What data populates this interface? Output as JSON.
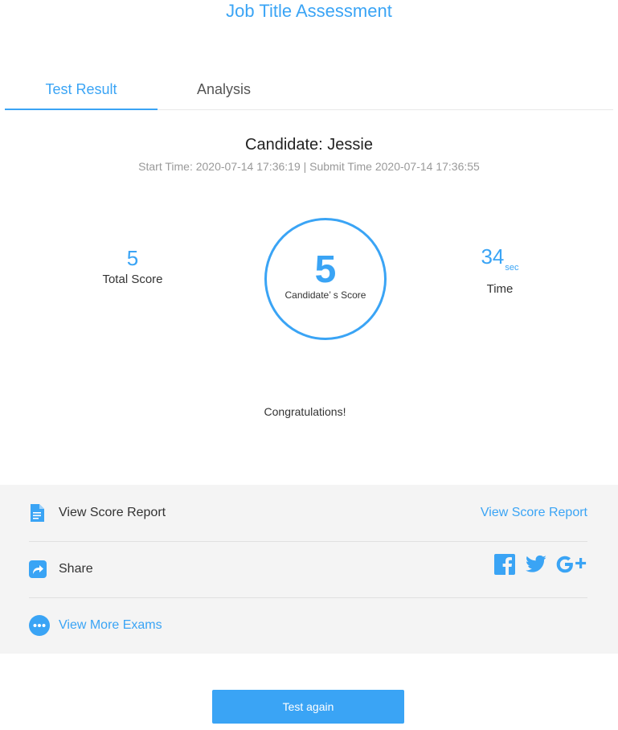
{
  "page": {
    "title": "Job Title Assessment"
  },
  "tabs": [
    {
      "label": "Test Result",
      "active": true
    },
    {
      "label": "Analysis",
      "active": false
    }
  ],
  "candidate": {
    "heading": "Candidate: Jessie",
    "times": "Start Time:  2020-07-14 17:36:19 | Submit Time 2020-07-14 17:36:55"
  },
  "stats": {
    "total_score_value": "5",
    "total_score_label": "Total Score",
    "candidate_score_value": "5",
    "candidate_score_label": "Candidate’ s Score",
    "time_value": "34",
    "time_unit": "sec",
    "time_label": "Time"
  },
  "message": "Congratulations!",
  "panel": {
    "score_report_label": "View Score Report",
    "score_report_link": "View Score Report",
    "share_label": "Share",
    "social_icons": [
      "facebook-icon",
      "twitter-icon",
      "google-plus-icon"
    ],
    "more_exams_label": "View More Exams"
  },
  "actions": {
    "test_again": "Test again"
  },
  "colors": {
    "accent": "#3aa4f5",
    "panel_bg": "#f4f4f4",
    "text": "#333333",
    "muted": "#999999"
  }
}
